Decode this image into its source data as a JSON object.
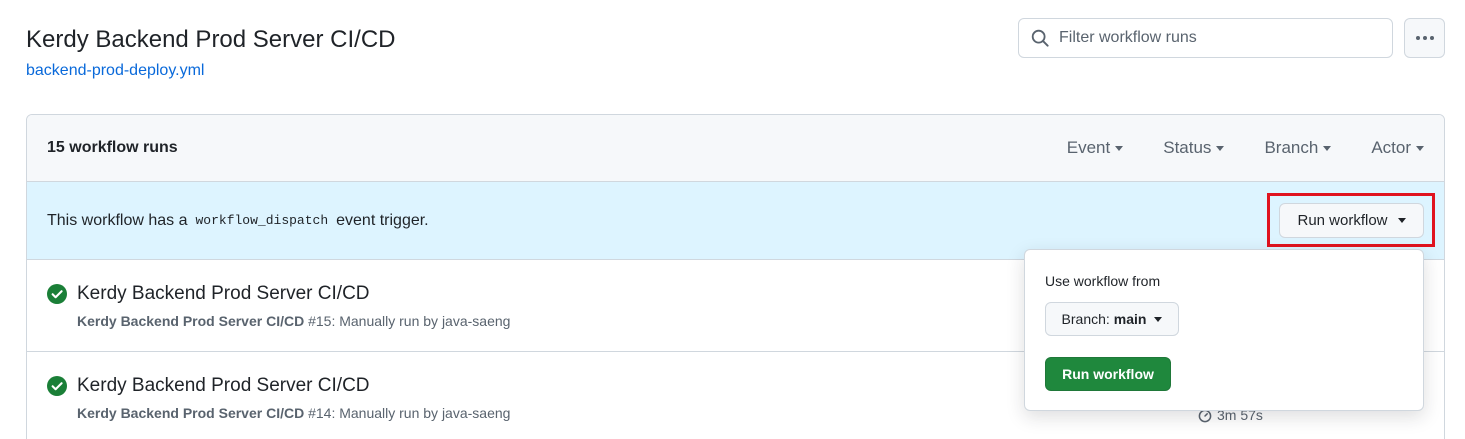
{
  "header": {
    "title": "Kerdy Backend Prod Server CI/CD",
    "file_link": "backend-prod-deploy.yml",
    "filter_placeholder": "Filter workflow runs"
  },
  "runs_box": {
    "count_label": "15 workflow runs",
    "filters": [
      "Event",
      "Status",
      "Branch",
      "Actor"
    ]
  },
  "dispatch_banner": {
    "text_before": "This workflow has a",
    "code": "workflow_dispatch",
    "text_after": "event trigger.",
    "run_button_label": "Run workflow"
  },
  "runs": [
    {
      "title": "Kerdy Backend Prod Server CI/CD",
      "workflow_name": "Kerdy Backend Prod Server CI/CD",
      "detail": "#15: Manually run by java-saeng"
    },
    {
      "title": "Kerdy Backend Prod Server CI/CD",
      "workflow_name": "Kerdy Backend Prod Server CI/CD",
      "detail": "#14: Manually run by java-saeng",
      "duration": "3m 57s"
    }
  ],
  "popover": {
    "label": "Use workflow from",
    "branch_prefix": "Branch:",
    "branch_value": "main",
    "submit_label": "Run workflow"
  },
  "colors": {
    "success": "#1a7f37",
    "primary_button": "#1f883d",
    "banner": "#ddf4ff",
    "highlight_box": "#e0131f",
    "link": "#0969da"
  },
  "icons": {
    "search": "search-icon",
    "more": "kebab-horizontal-icon",
    "status": "check-circle-fill-icon",
    "duration": "stopwatch-icon",
    "dropdown": "triangle-down-icon"
  }
}
